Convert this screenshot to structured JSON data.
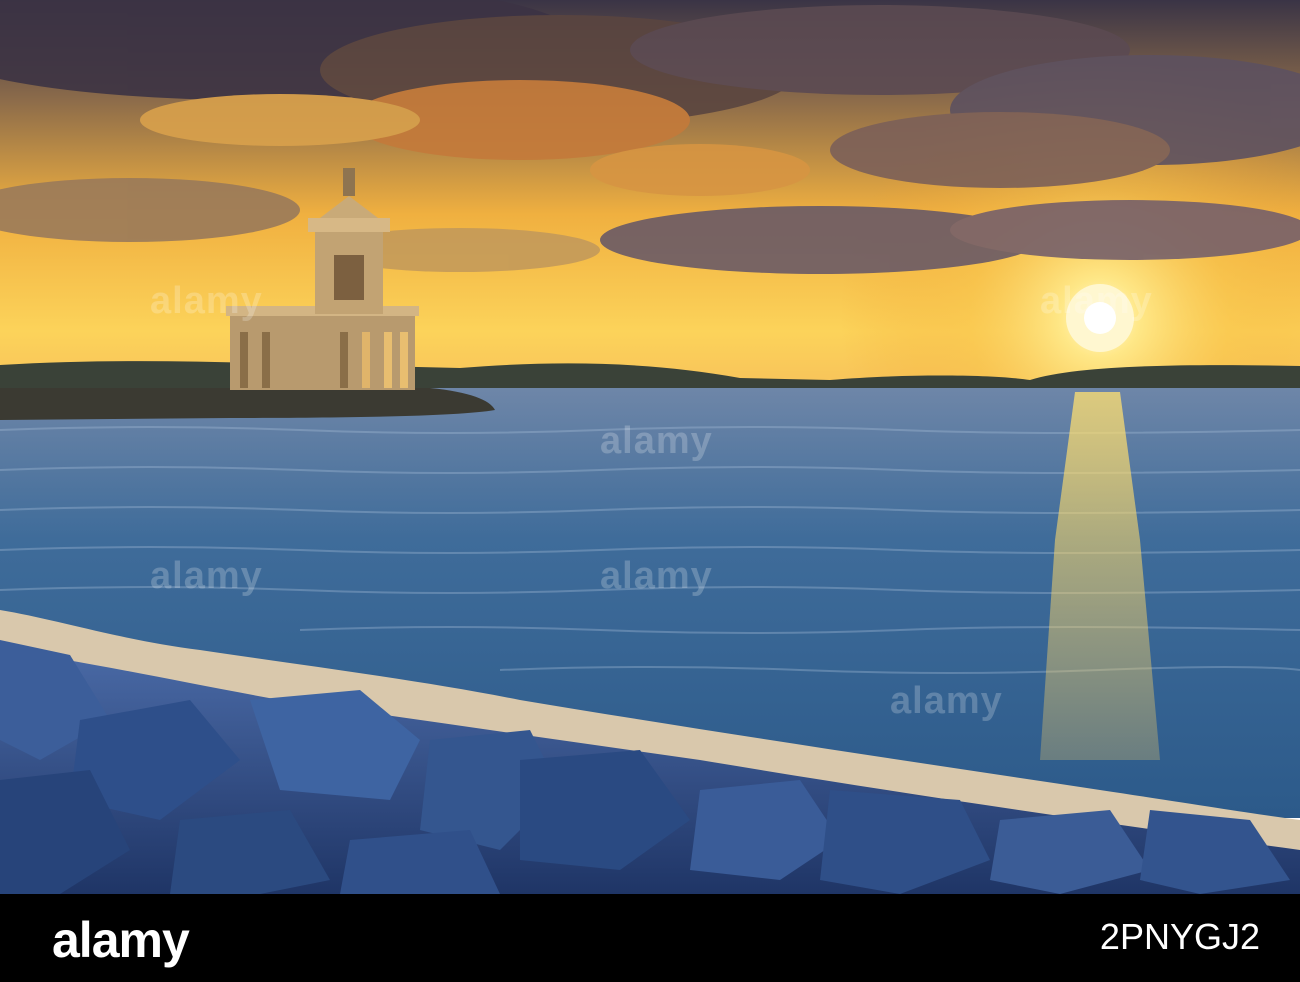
{
  "watermark": {
    "text": "alamy"
  },
  "footer": {
    "logo_text": "alamy",
    "image_id": "2PNYGJ2"
  },
  "colors": {
    "sky_top": "#3a3446",
    "sky_glow": "#f6b43a",
    "sun": "#fff2b0",
    "water": "#3d6f9c",
    "rocks": "#2f4f86",
    "footer_bg": "#000000"
  }
}
